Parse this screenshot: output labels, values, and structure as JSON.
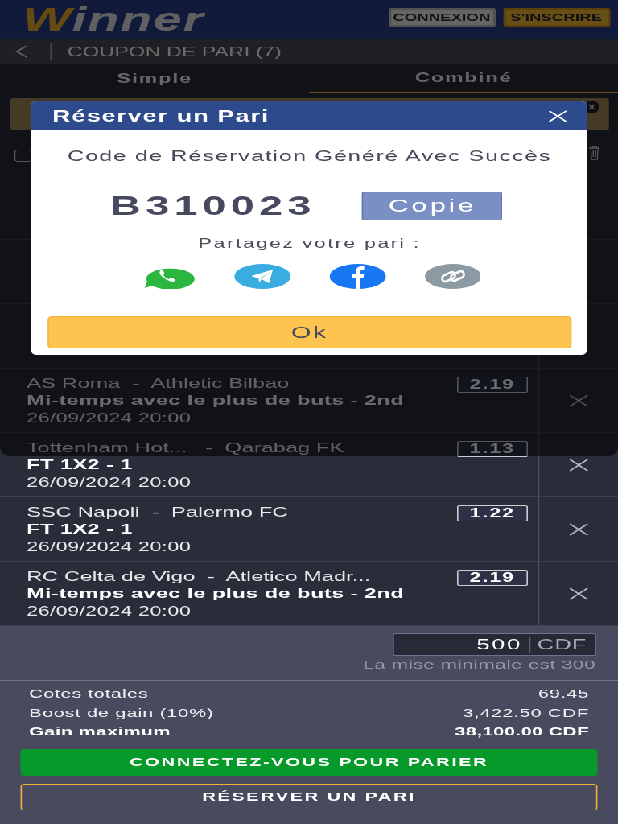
{
  "header": {
    "logo": "Winner",
    "buttons": [
      {
        "label": "CONNEXION",
        "kind": "login"
      },
      {
        "label": "S'INSCRIRE",
        "kind": "register"
      }
    ]
  },
  "coupon": {
    "title": "COUPON DE PARI (7)"
  },
  "tabs": [
    {
      "label": "Simple",
      "selected": false
    },
    {
      "label": "Combiné",
      "selected": true
    }
  ],
  "select_all": {
    "checked": false
  },
  "bets": [
    {
      "teams": "AS Roma  -  Athletic Bilbao",
      "market": "Mi-temps avec le plus de buts - 2nd",
      "date": "26/09/2024 20:00",
      "odds": "2.19"
    },
    {
      "teams": "Tottenham Hot...   -  Qarabag FK",
      "market": "FT 1X2 - 1",
      "date": "26/09/2024 20:00",
      "odds": "1.13"
    },
    {
      "teams": "SSC Napoli  -  Palermo FC",
      "market": "FT 1X2 - 1",
      "date": "26/09/2024 20:00",
      "odds": "1.22"
    },
    {
      "teams": "RC Celta de Vigo  -  Atletico Madr...",
      "market": "Mi-temps avec le plus de buts - 2nd",
      "date": "26/09/2024 20:00",
      "odds": "2.19"
    }
  ],
  "stake": {
    "value": "500",
    "currency": "CDF",
    "hint": "La mise minimale est 300"
  },
  "summary": [
    {
      "label": "Cotes totales",
      "value": "69.45",
      "emphasis": false
    },
    {
      "label": "Boost de gain (10%)",
      "value": "3,422.50 CDF",
      "emphasis": false
    },
    {
      "label": "Gain maximum",
      "value": "38,100.00 CDF",
      "emphasis": true
    }
  ],
  "actions": [
    {
      "label": "CONNECTEZ-VOUS POUR PARIER",
      "kind": "primary"
    },
    {
      "label": "RÉSERVER UN PARI",
      "kind": "outline"
    }
  ],
  "modal": {
    "title": "Réserver un Pari",
    "message": "Code de Réservation Généré Avec Succès",
    "code": "B310023",
    "copy_button": "Copie",
    "share_label": "Partagez votre pari :",
    "share": [
      {
        "kind": "whatsapp"
      },
      {
        "kind": "telegram"
      },
      {
        "kind": "facebook"
      },
      {
        "kind": "link"
      }
    ],
    "ok_button": "Ok"
  }
}
